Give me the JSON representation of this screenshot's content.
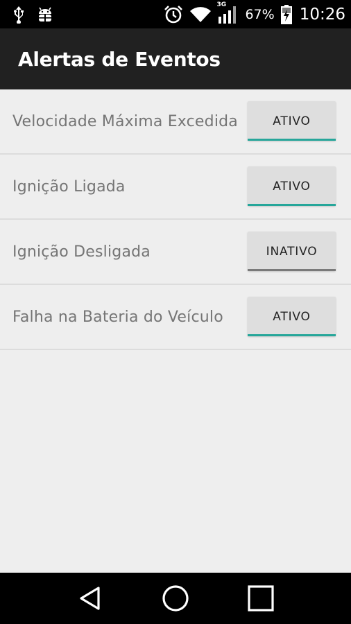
{
  "status_bar": {
    "network_type": "3G",
    "battery_percent": "67%",
    "time": "10:26",
    "icons": [
      "usb-icon",
      "android-debug-icon",
      "alarm-icon",
      "wifi-icon",
      "signal-icon",
      "battery-charging-icon"
    ]
  },
  "app_bar": {
    "title": "Alertas de Eventos"
  },
  "alerts": [
    {
      "label": "Velocidade Máxima Excedida",
      "toggle": "ATIVO",
      "on": true
    },
    {
      "label": "Ignição Ligada",
      "toggle": "ATIVO",
      "on": true
    },
    {
      "label": "Ignição Desligada",
      "toggle": "INATIVO",
      "on": false
    },
    {
      "label": "Falha na Bateria do Veículo",
      "toggle": "ATIVO",
      "on": true
    }
  ],
  "nav_bar": {
    "icons": [
      "back-icon",
      "home-icon",
      "recents-icon"
    ]
  },
  "colors": {
    "status_bar": "#000000",
    "app_bar": "#212121",
    "background": "#eeeeee",
    "toggle_on_accent": "#26a69a",
    "toggle_off_accent": "#7a7a7a"
  }
}
